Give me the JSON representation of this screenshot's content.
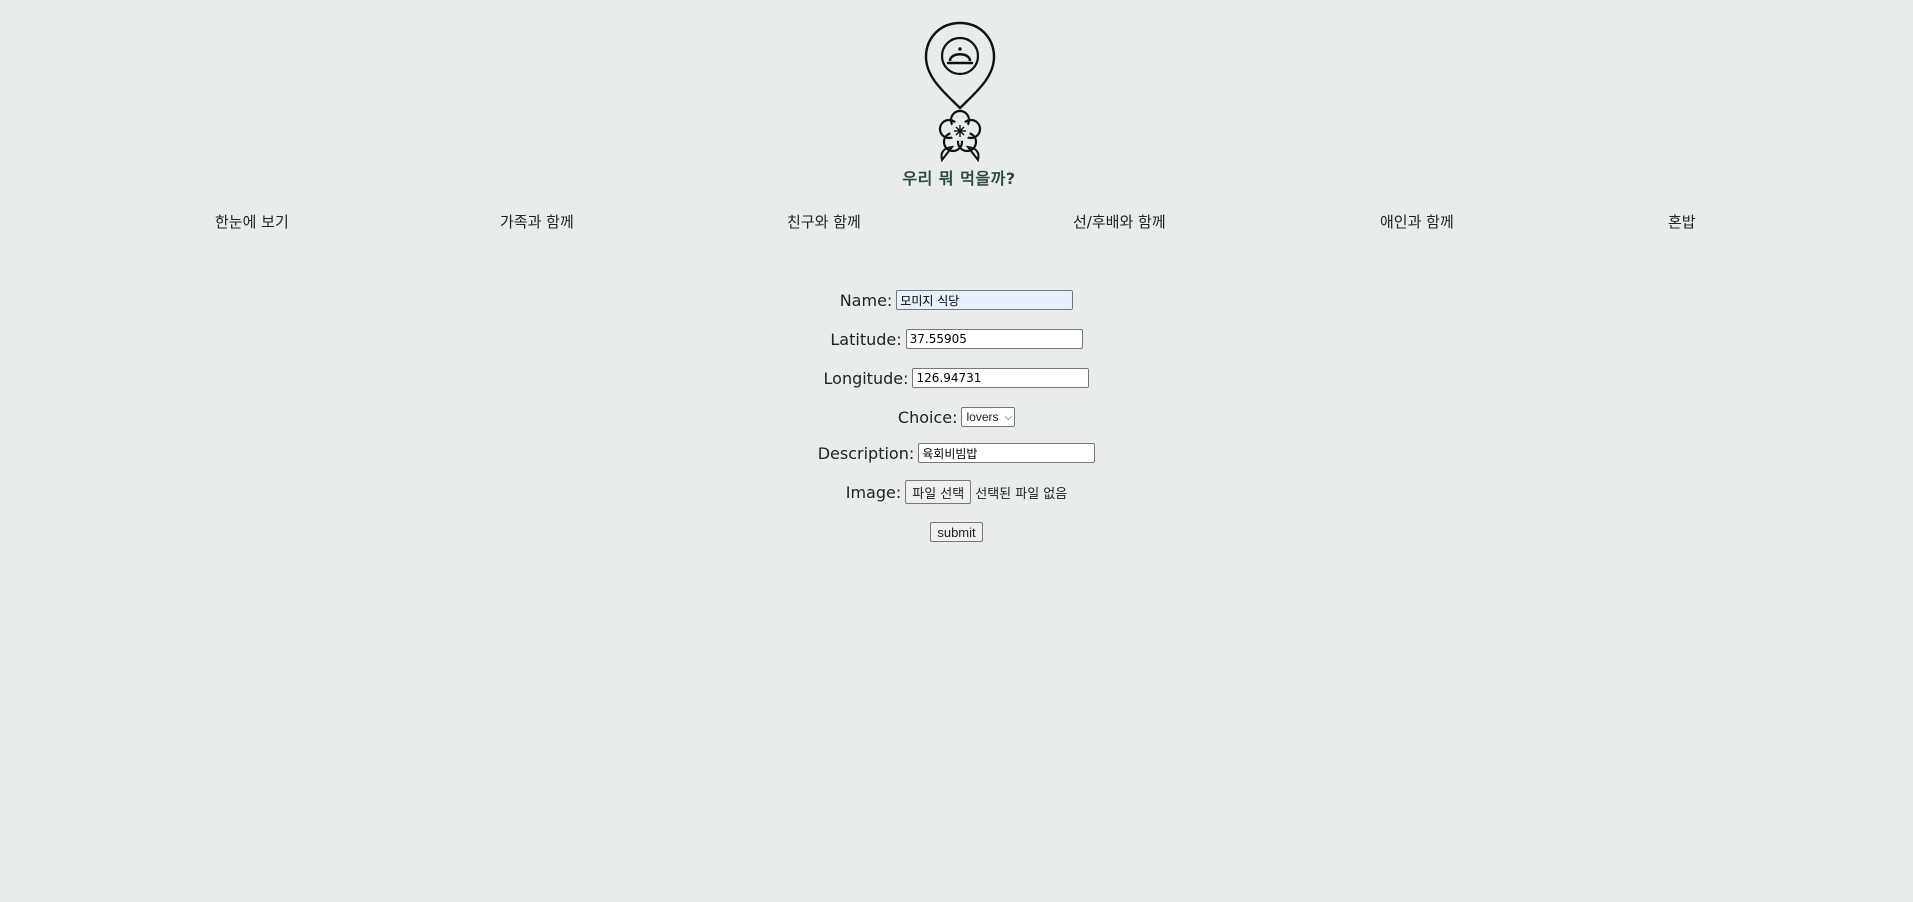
{
  "header": {
    "logo_icon": "map-pin-cloche-flower-logo",
    "title": "우리 뭐 먹을까?",
    "title_color": "#2e4b3a"
  },
  "nav": {
    "items": [
      {
        "label": "한눈에 보기"
      },
      {
        "label": "가족과 함께"
      },
      {
        "label": "친구와 함께"
      },
      {
        "label": "선/후배와 함께"
      },
      {
        "label": "애인과 함께"
      },
      {
        "label": "혼밥"
      }
    ]
  },
  "form": {
    "name": {
      "label": "Name:",
      "value": "모미지 식당"
    },
    "latitude": {
      "label": "Latitude:",
      "value": "37.55905"
    },
    "longitude": {
      "label": "Longitude:",
      "value": "126.94731"
    },
    "choice": {
      "label": "Choice:",
      "selected": "lovers"
    },
    "description": {
      "label": "Description:",
      "value": "육회비빔밥"
    },
    "image": {
      "label": "Image:",
      "button_label": "파일 선택",
      "status": "선택된 파일 없음"
    },
    "submit_label": "submit"
  },
  "colors": {
    "background": "#e8ecec",
    "autofill": "#e8f0fe"
  }
}
